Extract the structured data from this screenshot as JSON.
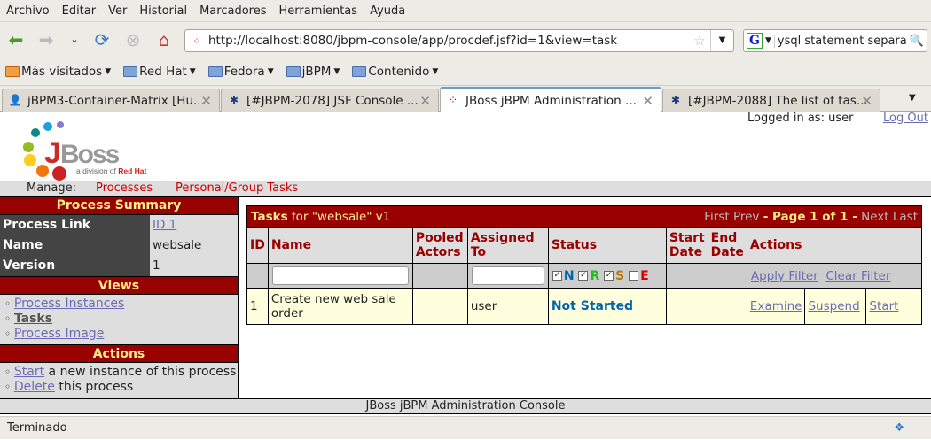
{
  "browser": {
    "menu": [
      "Archivo",
      "Editar",
      "Ver",
      "Historial",
      "Marcadores",
      "Herramientas",
      "Ayuda"
    ],
    "url": "http://localhost:8080/jbpm-console/app/procdef.jsf?id=1&view=task",
    "search_value": "ysql statement separat",
    "bookmarks": [
      "Más visitados",
      "Red Hat",
      "Fedora",
      "jBPM",
      "Contenido"
    ],
    "tabs": [
      "jBPM3-Container-Matrix [Hu...",
      "[#JBPM-2078] JSF Console ...",
      "JBoss jBPM Administration ...",
      "[#JBPM-2088] The list of tas..."
    ],
    "status": "Terminado"
  },
  "header": {
    "logged_in": "Logged in as: user",
    "logout": "Log Out",
    "logo_text": "JBoss",
    "logo_sub": "a division of Red Hat"
  },
  "manage": {
    "label": "Manage:",
    "processes": "Processes",
    "tasks": "Personal/Group Tasks"
  },
  "sidebar": {
    "summary_title": "Process Summary",
    "rows": [
      {
        "k": "Process Link",
        "v": "ID 1"
      },
      {
        "k": "Name",
        "v": "websale"
      },
      {
        "k": "Version",
        "v": "1"
      }
    ],
    "views_title": "Views",
    "views": [
      "Process Instances",
      "Tasks",
      "Process Image"
    ],
    "actions_title": "Actions",
    "actions": [
      {
        "link": "Start",
        "text": " a new instance of this process"
      },
      {
        "link": "Delete",
        "text": " this process"
      }
    ]
  },
  "tasks": {
    "title_bold": "Tasks",
    "title_rest": " for \"websale\" v1",
    "pager": {
      "first": "First",
      "prev": "Prev",
      "page": "- Page 1 of 1 -",
      "next": "Next",
      "last": "Last"
    },
    "columns": [
      "ID",
      "Name",
      "Pooled Actors",
      "Assigned To",
      "Status",
      "Start Date",
      "End Date",
      "Actions"
    ],
    "status_filters": [
      {
        "l": "N",
        "checked": true,
        "color": "#0066aa"
      },
      {
        "l": "R",
        "checked": true,
        "color": "#22bb22"
      },
      {
        "l": "S",
        "checked": true,
        "color": "#bb7700"
      },
      {
        "l": "E",
        "checked": false,
        "color": "#dd0000"
      }
    ],
    "apply_filter": "Apply Filter",
    "clear_filter": "Clear Filter",
    "rows": [
      {
        "id": "1",
        "name": "Create new web sale order",
        "pooled": "",
        "assigned": "user",
        "status": "Not Started",
        "start": "",
        "end": "",
        "actions": [
          "Examine",
          "Suspend",
          "Start"
        ]
      }
    ]
  },
  "footer": "JBoss jBPM Administration Console"
}
